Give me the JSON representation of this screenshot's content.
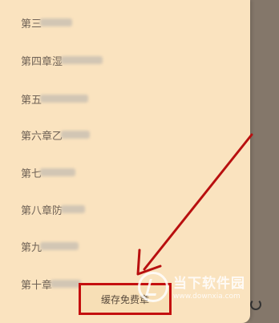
{
  "chapters": [
    {
      "label": "第三",
      "blur_width": 40
    },
    {
      "label": "第四章湿",
      "blur_width": 52
    },
    {
      "label": "第五",
      "blur_width": 60
    },
    {
      "label": "第六章乙",
      "blur_width": 36
    },
    {
      "label": "第七",
      "blur_width": 44
    },
    {
      "label": "第八章防",
      "blur_width": 30
    },
    {
      "label": "第九",
      "blur_width": 48
    },
    {
      "label": "第十章",
      "blur_width": 38
    }
  ],
  "cache_button": {
    "label": "缓存免费章"
  },
  "watermark": {
    "title": "当下软件园",
    "url": "www.downxia.com"
  },
  "colors": {
    "panel": "#fae3bf",
    "highlight": "#c40f0f",
    "arrow": "#b80f0f"
  }
}
